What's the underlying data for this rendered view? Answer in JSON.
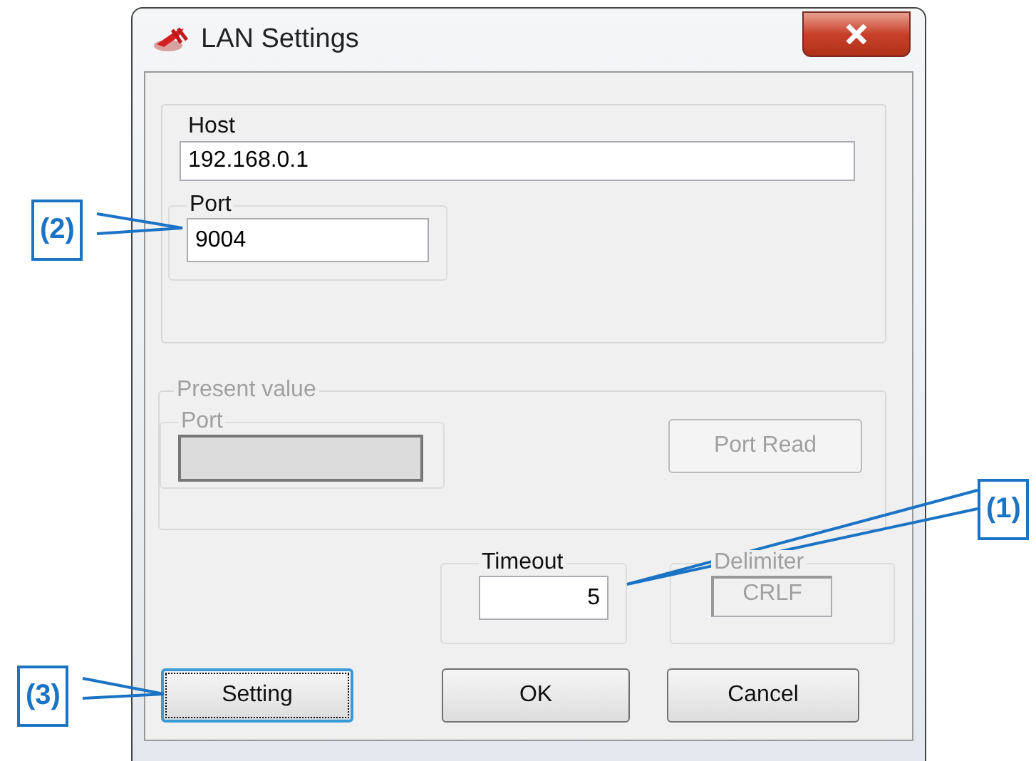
{
  "window": {
    "title": "LAN Settings"
  },
  "connection": {
    "host": {
      "label": "Host",
      "value": "192.168.0.1"
    },
    "port": {
      "label": "Port",
      "value": "9004"
    }
  },
  "present_value": {
    "title": "Present value",
    "disabled": true,
    "port": {
      "label": "Port"
    },
    "read_button": "Port Read"
  },
  "timeout": {
    "label": "Timeout",
    "value": "5"
  },
  "delimiter": {
    "label": "Delimiter",
    "value": "CRLF",
    "disabled": true
  },
  "buttons": [
    {
      "label": "Setting",
      "focused": true
    },
    {
      "label": "OK",
      "focused": false
    },
    {
      "label": "Cancel",
      "focused": false
    }
  ],
  "callouts": [
    {
      "label": "(2)"
    },
    {
      "label": "(1)"
    },
    {
      "label": "(3)"
    }
  ]
}
